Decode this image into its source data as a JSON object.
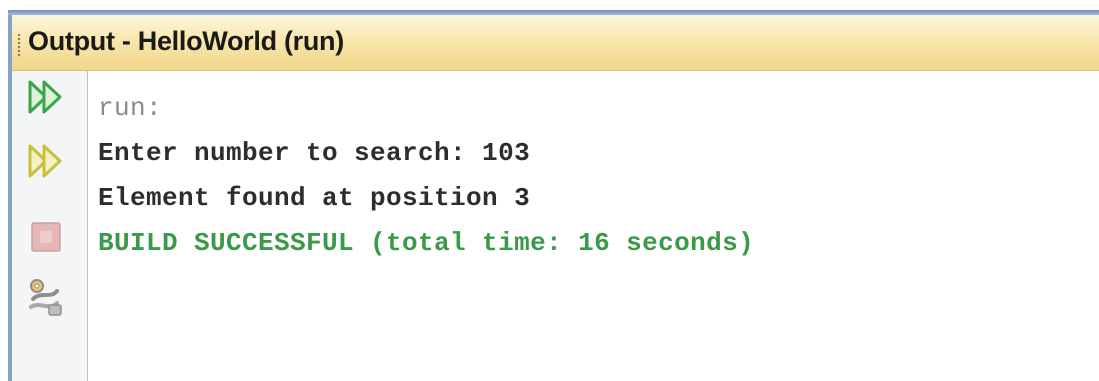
{
  "window": {
    "title": "Output - HelloWorld (run)"
  },
  "toolbar": {
    "buttons": [
      {
        "icon": "rerun-icon",
        "color": "#3aa64a"
      },
      {
        "icon": "rerun-with-options-icon",
        "color": "#c7c23a"
      },
      {
        "icon": "stop-icon",
        "color": "#d9a0a0"
      },
      {
        "icon": "settings-icon",
        "color": "#8a8a8a"
      }
    ]
  },
  "console": {
    "lines": [
      {
        "text": "run:",
        "kind": "run"
      },
      {
        "text": "Enter number to search: 103",
        "kind": "out"
      },
      {
        "text": "Element found at position 3",
        "kind": "out"
      },
      {
        "text": "BUILD SUCCESSFUL (total time: 16 seconds)",
        "kind": "ok"
      }
    ]
  },
  "colors": {
    "title_bar": "#f8e7ad",
    "build_success": "#3a9a4a",
    "program_output": "#2d2d2d",
    "run_label": "#8b8b8b"
  }
}
